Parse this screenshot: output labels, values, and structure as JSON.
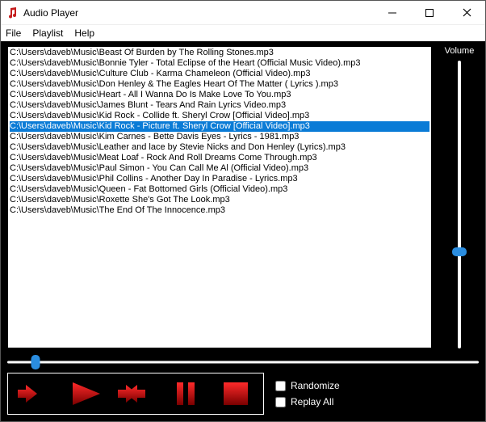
{
  "window": {
    "title": "Audio Player"
  },
  "menu": {
    "file": "File",
    "playlist": "Playlist",
    "help": "Help"
  },
  "playlist": {
    "selected_index": 7,
    "tracks": [
      "C:\\Users\\daveb\\Music\\Beast Of Burden by The Rolling Stones.mp3",
      "C:\\Users\\daveb\\Music\\Bonnie Tyler - Total Eclipse of the Heart (Official Music Video).mp3",
      "C:\\Users\\daveb\\Music\\Culture Club - Karma Chameleon (Official Video).mp3",
      "C:\\Users\\daveb\\Music\\Don Henley & The Eagles Heart Of The Matter ( Lyrics ).mp3",
      "C:\\Users\\daveb\\Music\\Heart - All I Wanna Do Is Make Love To You.mp3",
      "C:\\Users\\daveb\\Music\\James Blunt - Tears And Rain Lyrics Video.mp3",
      "C:\\Users\\daveb\\Music\\Kid Rock - Collide ft. Sheryl Crow [Official Video].mp3",
      "C:\\Users\\daveb\\Music\\Kid Rock - Picture ft. Sheryl Crow [Official Video].mp3",
      "C:\\Users\\daveb\\Music\\Kim Carnes - Bette Davis Eyes - Lyrics - 1981.mp3",
      "C:\\Users\\daveb\\Music\\Leather and lace by Stevie Nicks and Don Henley (Lyrics).mp3",
      "C:\\Users\\daveb\\Music\\Meat Loaf - Rock And Roll Dreams Come Through.mp3",
      "C:\\Users\\daveb\\Music\\Paul Simon - You Can Call Me Al (Official Video).mp3",
      "C:\\Users\\daveb\\Music\\Phil Collins - Another Day In Paradise - Lyrics.mp3",
      "C:\\Users\\daveb\\Music\\Queen - Fat Bottomed Girls (Official Video).mp3",
      "C:\\Users\\daveb\\Music\\Roxette She's Got The Look.mp3",
      "C:\\Users\\daveb\\Music\\The End Of The Innocence.mp3"
    ]
  },
  "volume": {
    "label": "Volume",
    "value_percent": 32
  },
  "seek": {
    "value_percent": 6
  },
  "options": {
    "randomize_label": "Randomize",
    "randomize_checked": false,
    "replay_all_label": "Replay All",
    "replay_all_checked": false
  },
  "colors": {
    "accent_red": "#d00000",
    "accent_red_dark": "#6a0000",
    "slider_blue": "#2a8de0"
  }
}
